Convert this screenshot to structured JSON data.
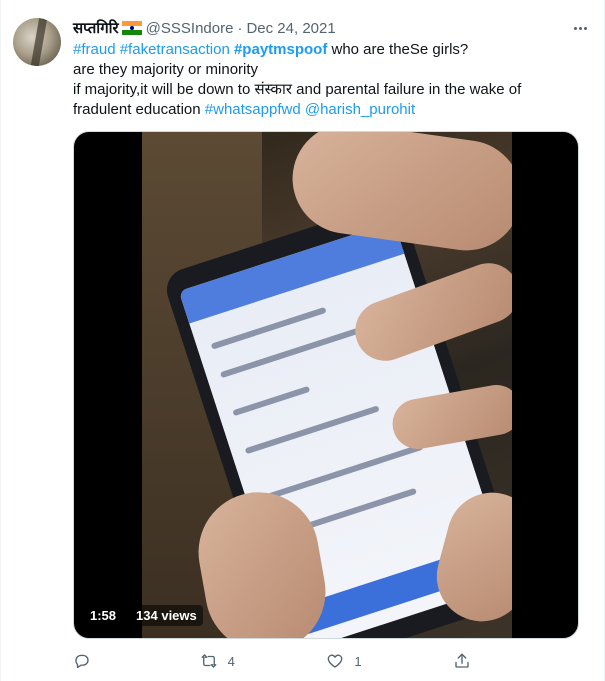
{
  "tweet": {
    "author_name": "सप्तगिरि",
    "handle": "@SSSIndore",
    "separator": "·",
    "date": "Dec 24, 2021",
    "text": {
      "line1": {
        "tag1": "#fraud",
        "tag2": "#faketransaction",
        "tag3": "#paytmspoof",
        "rest": " who are theSe girls?"
      },
      "line2": "are they majority or minority",
      "line3": "if majority,it will be down to संस्कार and parental failure in the wake of",
      "line4": {
        "plain": "fradulent education ",
        "tag": "#whatsappfwd",
        "mention": "@harish_purohit"
      }
    },
    "video": {
      "duration": "1:58",
      "views": "134 views"
    },
    "actions": {
      "reply_count": "",
      "retweet_count": "4",
      "like_count": "1"
    }
  },
  "icons": [
    "india-flag-icon",
    "more-icon",
    "reply-icon",
    "retweet-icon",
    "like-icon",
    "share-icon"
  ],
  "colors": {
    "link": "#1d9bf0",
    "muted": "#536471",
    "text": "#0f1419"
  }
}
